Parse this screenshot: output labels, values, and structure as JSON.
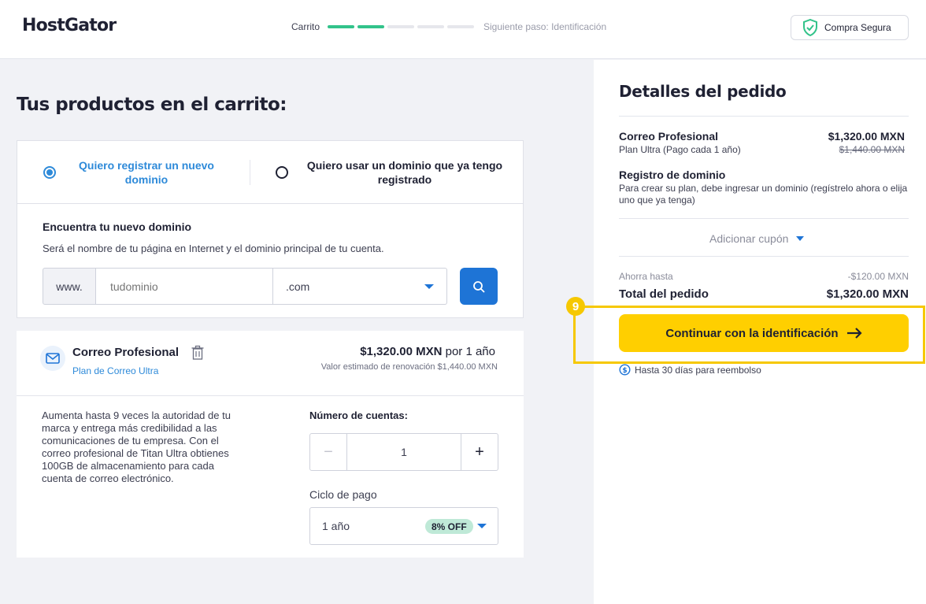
{
  "header": {
    "logo": "HostGator",
    "progress_label": "Carrito",
    "progress_steps_done": 2,
    "progress_steps_total": 5,
    "next_step": "Siguiente paso: Identificación",
    "secure_label": "Compra Segura"
  },
  "main": {
    "title": "Tus productos en el carrito:",
    "options": [
      {
        "label": "Quiero registrar un nuevo dominio",
        "selected": true
      },
      {
        "label": "Quiero usar un dominio que ya tengo registrado",
        "selected": false
      }
    ],
    "find_title": "Encuentra tu nuevo dominio",
    "find_subtitle": "Será el nombre de tu página en Internet y el dominio principal de tu cuenta.",
    "prefix": "www.",
    "domain_placeholder": "tudominio",
    "tld": ".com"
  },
  "product": {
    "name": "Correo Profesional",
    "plan": "Plan de Correo Ultra",
    "price": "$1,320.00 MXN",
    "period": "por 1 año",
    "renewal": "Valor estimado de renovación $1,440.00 MXN",
    "description": "Aumenta hasta 9 veces la autoridad de tu marca y entrega más credibilidad a las comunicaciones de tu empresa. Con el correo profesional de Titan Ultra obtienes 100GB de almacenamiento para cada cuenta de correo electrónico.",
    "accounts_label": "Número de cuentas:",
    "accounts_minus": "−",
    "accounts_value": "1",
    "accounts_plus": "+",
    "cycle_label": "Ciclo de pago",
    "cycle_value": "1 año",
    "cycle_badge": "8% OFF"
  },
  "summary": {
    "title": "Detalles del pedido",
    "item_name": "Correo Profesional",
    "item_sub": "Plan Ultra (Pago cada 1 año)",
    "item_price": "$1,320.00 MXN",
    "item_old_price": "$1,440.00 MXN",
    "reg_name": "Registro de dominio",
    "reg_sub": "Para crear su plan, debe ingresar un dominio (regístrelo ahora o elija uno que ya tenga)",
    "coupon": "Adicionar cupón",
    "save_label": "Ahorra hasta",
    "save_value": "-$120.00 MXN",
    "total_label": "Total del pedido",
    "total_value": "$1,320.00 MXN",
    "step_badge": "9",
    "cta": "Continuar con la identificación",
    "refund": "Hasta 30 días para reembolso"
  },
  "colors": {
    "accent_blue": "#1e74d6",
    "progress_green": "#32c38a",
    "cta_yellow": "#ffcf00",
    "highlight": "#f6c800"
  }
}
